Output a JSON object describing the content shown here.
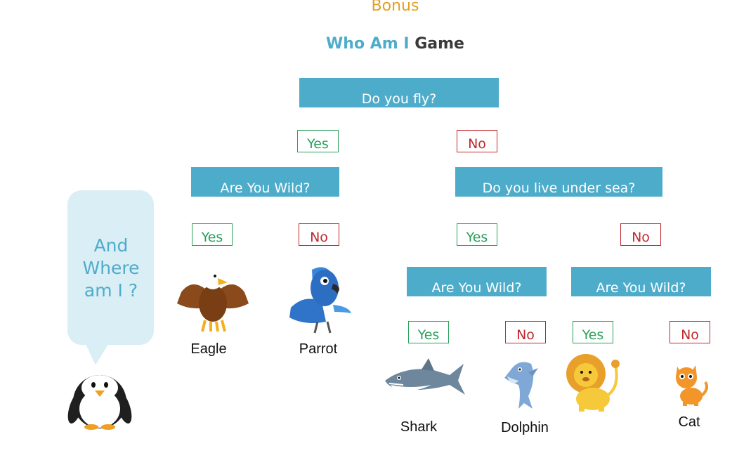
{
  "header": {
    "bonus": "Bonus",
    "title_a": "Who Am I",
    "title_b": "Game"
  },
  "questions": {
    "q1": "Do you fly?",
    "q2": "Are You Wild?",
    "q3": "Do you live under sea?",
    "q4": "Are You Wild?",
    "q5": "Are You Wild?"
  },
  "answers": {
    "yes": "Yes",
    "no": "No"
  },
  "animals": {
    "eagle": "Eagle",
    "parrot": "Parrot",
    "shark": "Shark",
    "dolphin": "Dolphin",
    "cat": "Cat"
  },
  "bubble": {
    "line1": "And",
    "line2": "Where",
    "line3": "am I ?"
  },
  "colors": {
    "teal": "#4eaccb",
    "yes": "#2aa05a",
    "no": "#c0282c",
    "bonus": "#e0a020"
  }
}
